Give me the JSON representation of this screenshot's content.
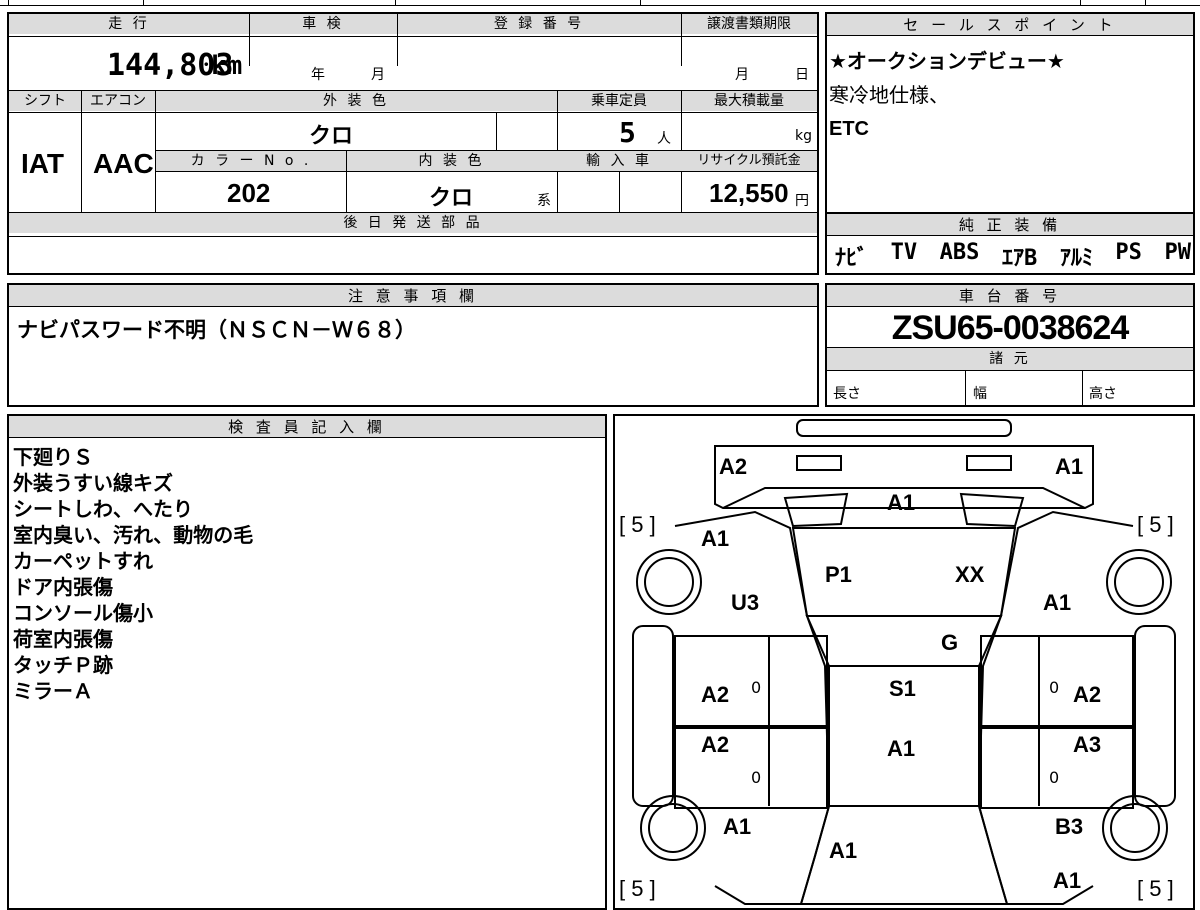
{
  "vehicle_info": {
    "headers": {
      "mileage": "走 行",
      "inspection": "車 検",
      "registration": "登 録 番 号",
      "transfer_deadline": "譲渡書類期限",
      "shift": "シフト",
      "aircon": "エアコン",
      "exterior_color": "外 装 色",
      "capacity": "乗車定員",
      "max_load": "最大積載量",
      "color_no": "カ ラ ー N o .",
      "interior_color": "内 装 色",
      "import": "輸 入 車",
      "recycle": "リサイクル預託金",
      "later_parts": "後 日 発 送 部 品"
    },
    "mileage_value": "144,803",
    "mileage_unit": "km",
    "inspection_year_unit": "年",
    "inspection_month_unit": "月",
    "transfer_month_unit": "月",
    "transfer_day_unit": "日",
    "shift_value": "IAT",
    "aircon_value": "AAC",
    "exterior_color_value": "クロ",
    "capacity_value": "5",
    "capacity_unit": "人",
    "max_load_unit": "kg",
    "color_no_value": "202",
    "interior_color_value": "クロ",
    "interior_color_suffix": "系",
    "recycle_value": "12,550",
    "recycle_unit": "円"
  },
  "sales_points": {
    "header": "セ ー ル ス ポ イ ン ト",
    "lines": [
      "★オークションデビュー★",
      "寒冷地仕様、",
      "ETC"
    ]
  },
  "genuine_equipment": {
    "header": "純 正 装 備",
    "items": [
      "ﾅﾋﾞ",
      "TV",
      "ABS",
      "ｴｱB",
      "ｱﾙﾐ",
      "PS",
      "PW"
    ]
  },
  "notes": {
    "header": "注 意 事 項 欄",
    "text": "ナビパスワード不明（ＮＳＣＮ－Ｗ６８）"
  },
  "chassis": {
    "header": "車 台 番 号",
    "value": "ZSU65-0038624",
    "spec_header": "諸 元",
    "length_label": "長さ",
    "width_label": "幅",
    "height_label": "高さ"
  },
  "inspector": {
    "header": "検 査 員 記 入 欄",
    "lines": [
      "下廻りＳ",
      "外装うすい線キズ",
      "シートしわ、へたり",
      "室内臭い、汚れ、動物の毛",
      "カーペットすれ",
      "ドア内張傷",
      "コンソール傷小",
      "荷室内張傷",
      "タッチＰ跡",
      "ミラーＡ"
    ]
  },
  "diagram": {
    "codes": {
      "rear_left": "A2",
      "rear_right": "A1",
      "rear_glass": "A1",
      "left_quarter": "A1",
      "left_quarter2": "U3",
      "roof_left": "P1",
      "roof_right": "XX",
      "right_quarter": "A1",
      "sunroof_area": "G",
      "left_rear_door": "A2",
      "right_rear_door": "A2",
      "center": "S1",
      "left_front_door": "A2",
      "center2": "A1",
      "right_front_door": "A3",
      "left_fender": "A1",
      "right_fender": "B3",
      "hood": "A1",
      "front_right": "A1"
    },
    "tire_tl": "[ 5 ]",
    "tire_tr": "[ 5 ]",
    "tire_bl": "[ 5 ]",
    "tire_br": "[ 5 ]",
    "zero": "0"
  }
}
